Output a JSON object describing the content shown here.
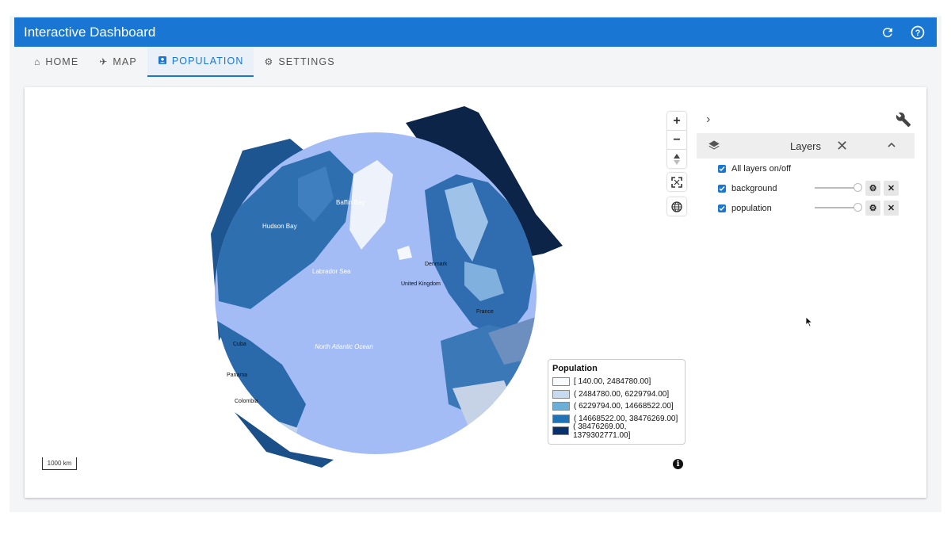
{
  "app": {
    "title": "Interactive Dashboard"
  },
  "appbar_icons": [
    "refresh-icon",
    "help-icon"
  ],
  "tabs": [
    {
      "label": "HOME",
      "icon": "home-icon"
    },
    {
      "label": "MAP",
      "icon": "airplane-icon"
    },
    {
      "label": "POPULATION",
      "icon": "contact-card-icon",
      "active": true
    },
    {
      "label": "SETTINGS",
      "icon": "gear-icon"
    }
  ],
  "map": {
    "labels": [
      "Baffin Bay",
      "Hudson Bay",
      "Labrador Sea",
      "North Atlantic Ocean",
      "Cuba",
      "Panama",
      "Colombia",
      "Denmark",
      "United Kingdom",
      "France"
    ],
    "scale_label": "1000 km",
    "controls": [
      "zoom-in-icon",
      "zoom-out-icon",
      "compass-icon",
      "fullscreen-icon",
      "globe-icon",
      "info-icon"
    ]
  },
  "legend": {
    "title": "Population",
    "items": [
      {
        "label": "[ 140.00, 2484780.00]",
        "color": "#f7fbff"
      },
      {
        "label": "( 2484780.00, 6229794.00]",
        "color": "#c6dbef"
      },
      {
        "label": "( 6229794.00, 14668522.00]",
        "color": "#6baed6"
      },
      {
        "label": "( 14668522.00, 38476269.00]",
        "color": "#2171b5"
      },
      {
        "label": "( 38476269.00, 1379302771.00]",
        "color": "#08306b"
      }
    ]
  },
  "layers_panel": {
    "title": "Layers",
    "all_toggle": {
      "label": "All layers on/off",
      "checked": true
    },
    "layers": [
      {
        "name": "background",
        "checked": true,
        "opacity": 1.0
      },
      {
        "name": "population",
        "checked": true,
        "opacity": 1.0
      }
    ]
  },
  "colors": {
    "accent": "#1976d2",
    "ocean": "#a3bcf5"
  }
}
